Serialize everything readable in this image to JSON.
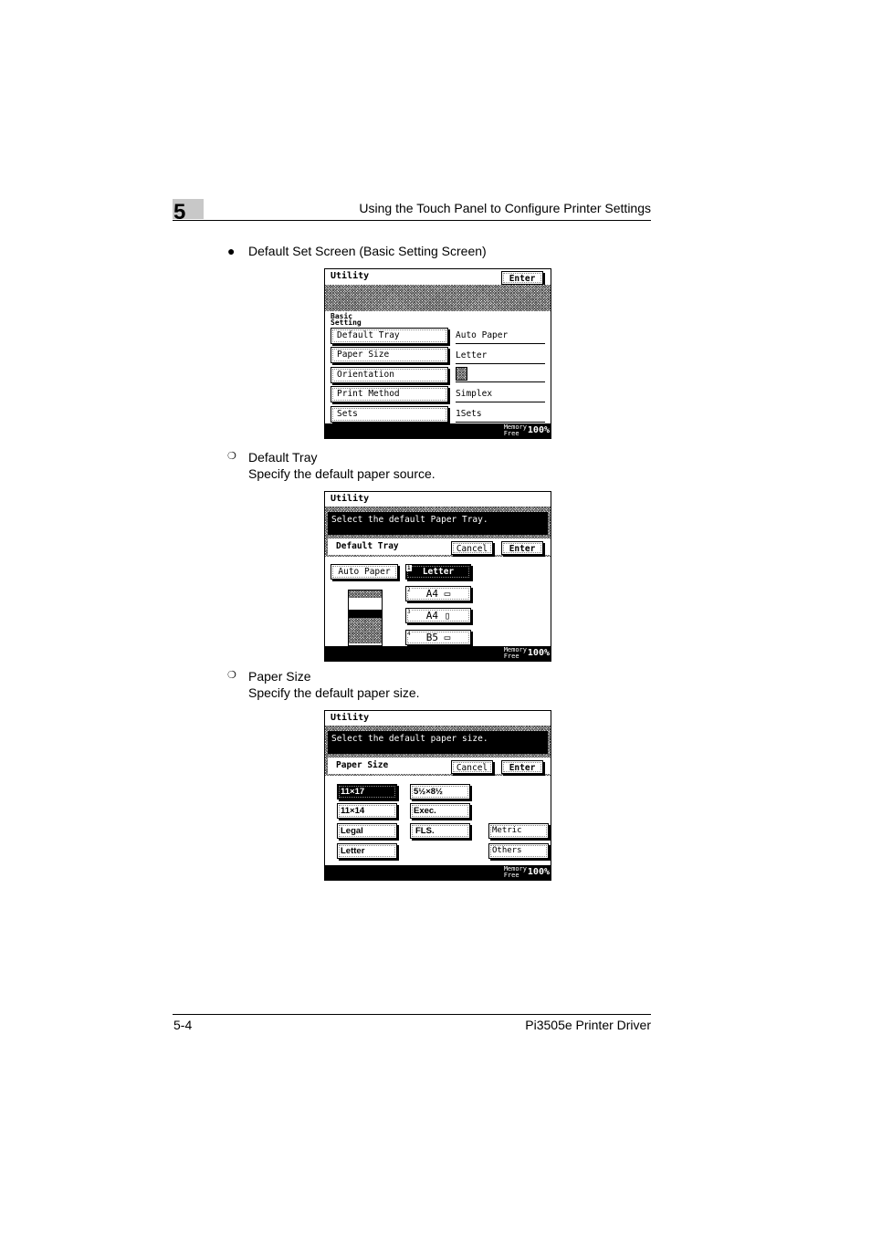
{
  "header": {
    "chapter": "5",
    "title": "Using the Touch Panel to Configure Printer Settings"
  },
  "footer": {
    "page": "5-4",
    "product": "Pi3505e Printer Driver"
  },
  "section1": {
    "bullet": "Default Set Screen (Basic Setting Screen)"
  },
  "screen1": {
    "title": "Utility",
    "enter": "Enter",
    "section_label_1": "Basic",
    "section_label_2": "Setting",
    "rows": [
      {
        "label": "Default Tray",
        "value": "Auto Paper"
      },
      {
        "label": "Paper Size",
        "value": "Letter"
      },
      {
        "label": "Orientation",
        "value": "",
        "icon": "portrait-orientation-icon"
      },
      {
        "label": "Print Method",
        "value": "Simplex"
      },
      {
        "label": "Sets",
        "value": "1Sets"
      }
    ],
    "memory_1": "Memory",
    "memory_2": "Free",
    "memory_pct": "100%"
  },
  "section2": {
    "title": "Default Tray",
    "desc": "Specify the default paper source."
  },
  "screen2": {
    "title": "Utility",
    "message": "Select the default Paper Tray.",
    "subtitle": "Default Tray",
    "cancel": "Cancel",
    "enter": "Enter",
    "auto_paper": "Auto Paper",
    "trays": [
      {
        "num": "1",
        "label": "Letter",
        "selected": true
      },
      {
        "num": "2",
        "label": "A4 ▭"
      },
      {
        "num": "3",
        "label": "A4 ▯"
      },
      {
        "num": "4",
        "label": "B5 ▭"
      }
    ],
    "memory_1": "Memory",
    "memory_2": "Free",
    "memory_pct": "100%"
  },
  "section3": {
    "title": "Paper Size",
    "desc": "Specify the default paper size."
  },
  "screen3": {
    "title": "Utility",
    "message": "Select the default paper size.",
    "subtitle": "Paper Size",
    "cancel": "Cancel",
    "enter": "Enter",
    "sizes_col1": [
      "11×17",
      "11×14",
      "Legal",
      "Letter"
    ],
    "sizes_col2": [
      "5½×8½",
      "Exec.",
      "FLS."
    ],
    "metric": "Metric",
    "others": "Others",
    "memory_1": "Memory",
    "memory_2": "Free",
    "memory_pct": "100%"
  }
}
